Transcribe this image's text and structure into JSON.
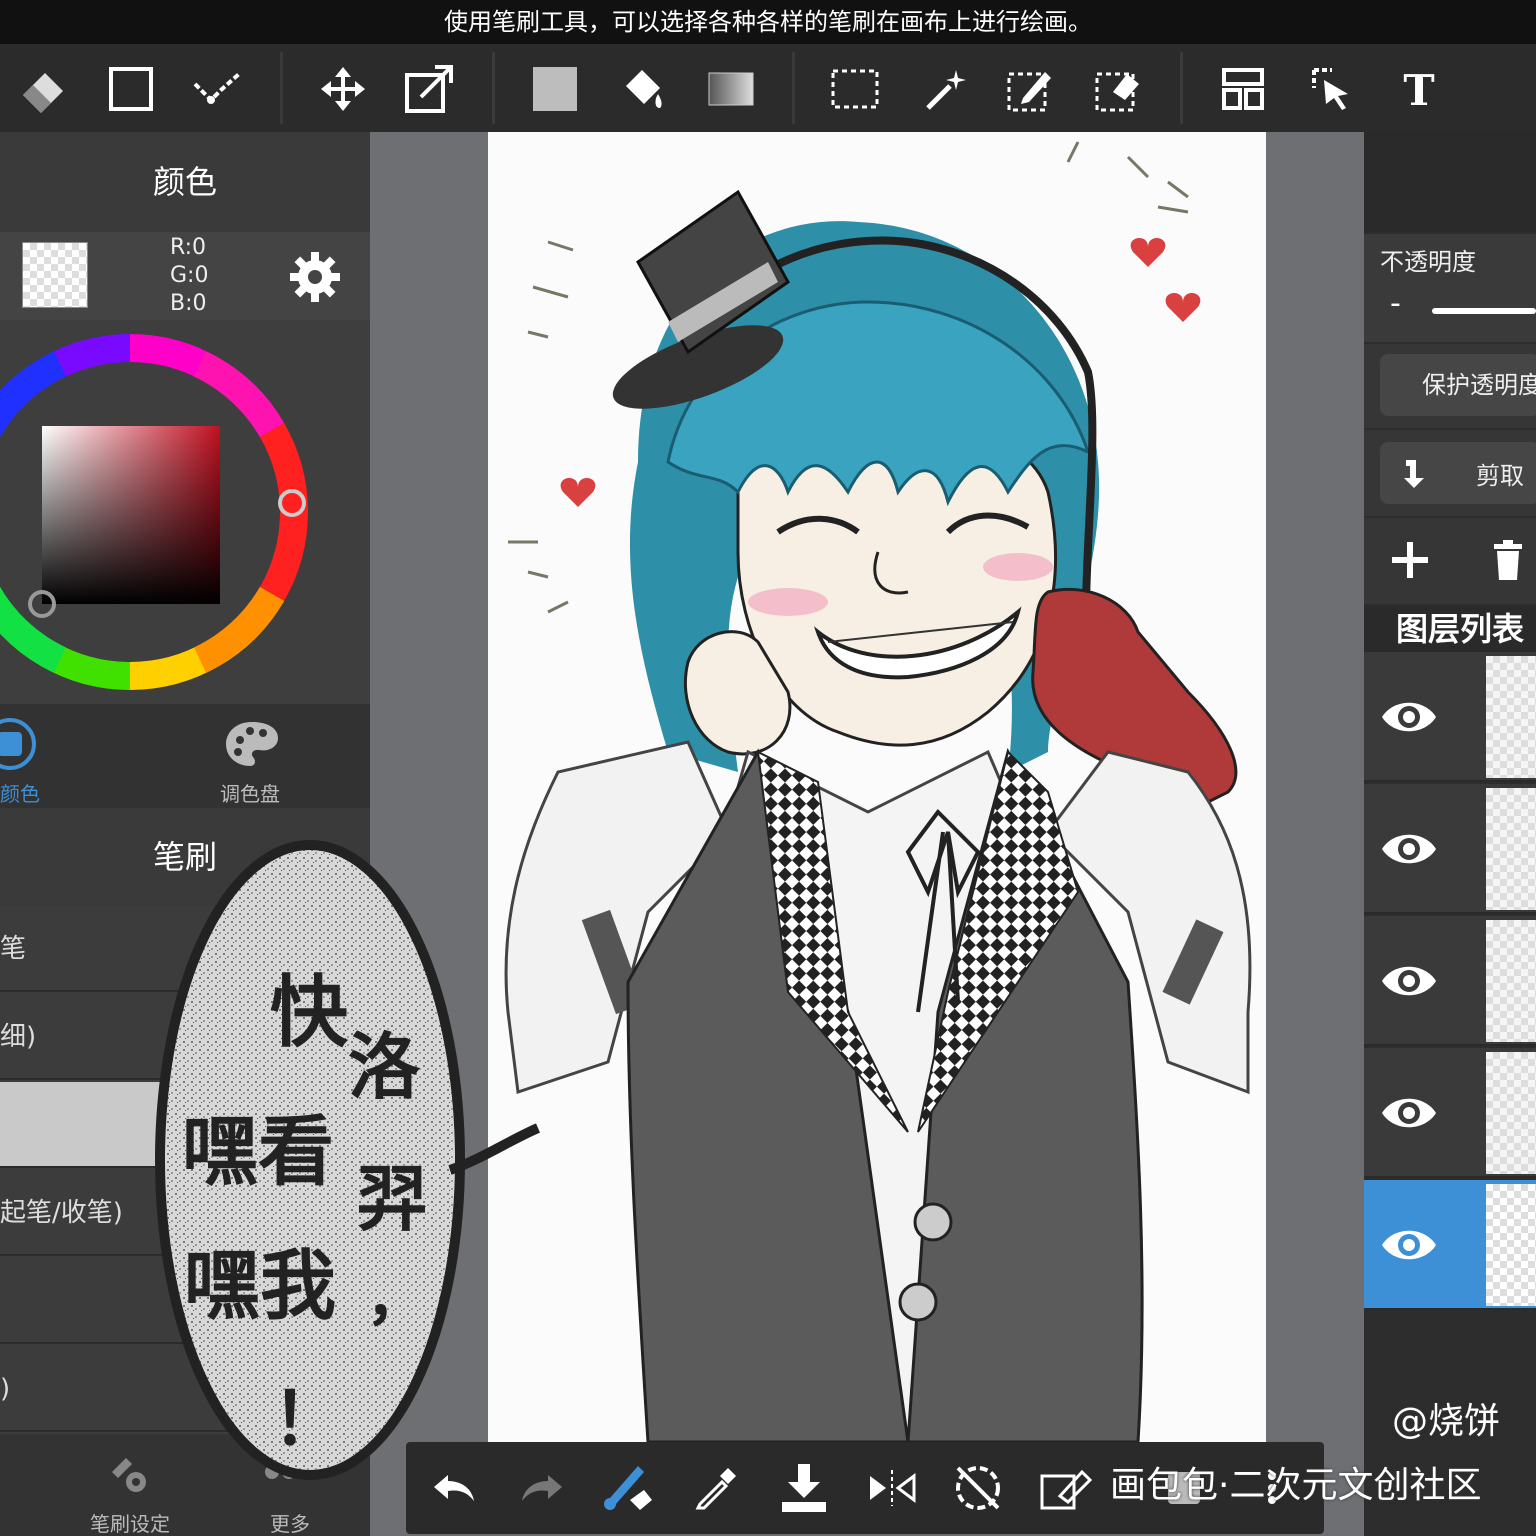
{
  "hint": "使用笔刷工具，可以选择各种各样的笔刷在画布上进行绘画。",
  "left_panel": {
    "color_title": "颜色",
    "rgb": {
      "r": "R:0",
      "g": "G:0",
      "b": "B:0"
    },
    "tabs": [
      {
        "label": "颜色",
        "icon": "color-square-icon"
      },
      {
        "label": "调色盘",
        "icon": "palette-icon"
      }
    ],
    "brush_title": "笔刷",
    "brush_items": [
      "笔",
      "细)",
      "",
      "起笔/收笔)",
      "",
      ")"
    ],
    "bottom_tabs": [
      {
        "label": "笔刷设定",
        "icon": "brush-settings-icon"
      },
      {
        "label": "更多",
        "icon": "more-icon"
      }
    ]
  },
  "right_panel": {
    "opacity_label": "不透明度",
    "opacity_minus": "-",
    "protect_alpha_label": "保护透明度",
    "clip_label": "剪取",
    "layer_list_title": "图层列表",
    "layers": [
      {
        "visible": true
      },
      {
        "visible": true
      },
      {
        "visible": true
      },
      {
        "visible": true
      },
      {
        "visible": true,
        "selected": true
      }
    ]
  },
  "bubble": {
    "line1": "快",
    "line2": "洛",
    "line3": "嘿看",
    "line4": "羿",
    "line5": "嘿我",
    "line6": "，",
    "line7": "！"
  },
  "watermark": {
    "author": "@烧饼",
    "site": "画包包·二次元文创社区"
  },
  "colors": {
    "accent": "#3d8fd6",
    "hair": "#2e8fa8",
    "glove": "#b03a3a"
  }
}
